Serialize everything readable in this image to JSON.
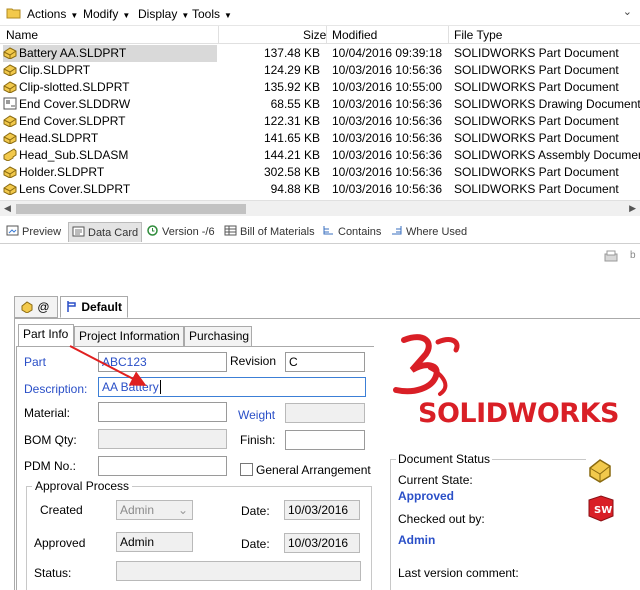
{
  "toolbar": {
    "menus": [
      {
        "label": "Actions"
      },
      {
        "label": "Modify"
      },
      {
        "label": "Display"
      },
      {
        "label": "Tools"
      }
    ]
  },
  "columns": {
    "name": "Name",
    "size": "Size",
    "modified": "Modified",
    "file_type": "File Type"
  },
  "files": [
    {
      "name": "Battery AA.SLDPRT",
      "size": "137.48 KB",
      "modified": "10/04/2016 09:39:18",
      "type": "SOLIDWORKS Part Document",
      "icon": "part-icon",
      "selected": true
    },
    {
      "name": "Clip.SLDPRT",
      "size": "124.29 KB",
      "modified": "10/03/2016 10:56:36",
      "type": "SOLIDWORKS Part Document",
      "icon": "part-icon"
    },
    {
      "name": "Clip-slotted.SLDPRT",
      "size": "135.92 KB",
      "modified": "10/03/2016 10:55:00",
      "type": "SOLIDWORKS Part Document",
      "icon": "part-icon"
    },
    {
      "name": "End Cover.SLDDRW",
      "size": "68.55 KB",
      "modified": "10/03/2016 10:56:36",
      "type": "SOLIDWORKS Drawing Document",
      "icon": "drawing-icon"
    },
    {
      "name": "End Cover.SLDPRT",
      "size": "122.31 KB",
      "modified": "10/03/2016 10:56:36",
      "type": "SOLIDWORKS Part Document",
      "icon": "part-icon"
    },
    {
      "name": "Head.SLDPRT",
      "size": "141.65 KB",
      "modified": "10/03/2016 10:56:36",
      "type": "SOLIDWORKS Part Document",
      "icon": "part-icon"
    },
    {
      "name": "Head_Sub.SLDASM",
      "size": "144.21 KB",
      "modified": "10/03/2016 10:56:36",
      "type": "SOLIDWORKS Assembly Document",
      "icon": "assembly-icon"
    },
    {
      "name": "Holder.SLDPRT",
      "size": "302.58 KB",
      "modified": "10/03/2016 10:56:36",
      "type": "SOLIDWORKS Part Document",
      "icon": "part-icon"
    },
    {
      "name": "Lens Cover.SLDPRT",
      "size": "94.88 KB",
      "modified": "10/03/2016 10:56:36",
      "type": "SOLIDWORKS Part Document",
      "icon": "part-icon"
    }
  ],
  "tabs": [
    {
      "label": "Preview",
      "icon": "preview-icon"
    },
    {
      "label": "Data Card",
      "icon": "data-card-icon",
      "active": true
    },
    {
      "label": "Version -/6",
      "icon": "version-icon"
    },
    {
      "label": "Bill of Materials",
      "icon": "bom-icon"
    },
    {
      "label": "Contains",
      "icon": "contains-icon"
    },
    {
      "label": "Where Used",
      "icon": "where-used-icon"
    }
  ],
  "card": {
    "config_tabs": [
      {
        "label": "@"
      },
      {
        "label": "Default"
      }
    ],
    "sub_tabs": [
      "Part Info",
      "Project Information",
      "Purchasing"
    ],
    "labels": {
      "part": "Part",
      "revision": "Revision",
      "description": "Description:",
      "material": "Material:",
      "weight": "Weight",
      "bom_qty": "BOM Qty:",
      "finish": "Finish:",
      "pdm_no": "PDM No.:",
      "general_arrangement": "General Arrangement",
      "approval_process": "Approval Process",
      "created": "Created",
      "approved": "Approved",
      "date": "Date:",
      "status": "Status:"
    },
    "values": {
      "part": "ABC123",
      "revision": "C",
      "description": "AA Battery",
      "material": "",
      "weight": "",
      "bom_qty": "",
      "finish": "",
      "pdm_no": "",
      "created_by": "Admin",
      "created_date": "10/03/2016",
      "approved_by": "Admin",
      "approved_date": "10/03/2016",
      "status": ""
    },
    "logo_text": "SOLIDWORKS",
    "document_status": {
      "legend": "Document Status",
      "current_state_label": "Current State:",
      "current_state": "Approved",
      "checked_out_label": "Checked out by:",
      "checked_out_by": "Admin",
      "last_comment_label": "Last version comment:"
    }
  },
  "colors": {
    "accent_blue": "#2a4fc7",
    "arrow_red": "#e02020",
    "logo_red": "#d91f26"
  }
}
